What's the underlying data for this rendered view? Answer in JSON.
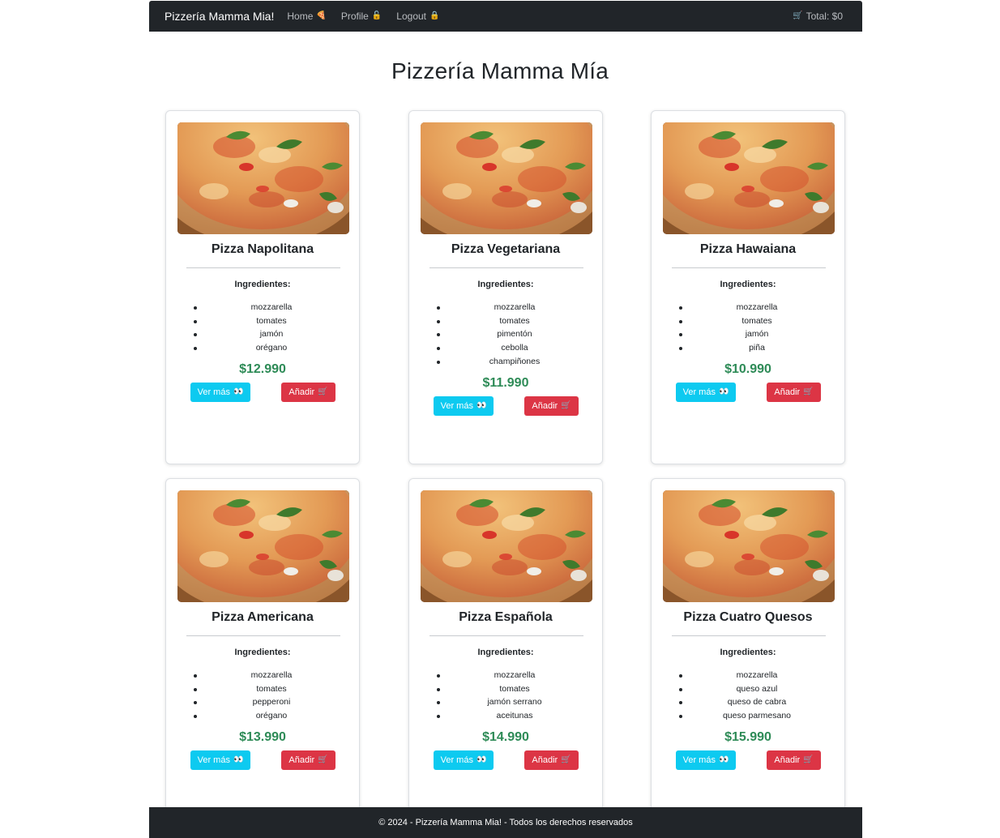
{
  "navbar": {
    "brand": "Pizzería Mamma Mia!",
    "links": [
      {
        "label": "Home",
        "icon": "🍕"
      },
      {
        "label": "Profile",
        "icon": "🔓"
      },
      {
        "label": "Logout",
        "icon": "🔒"
      }
    ],
    "total_icon": "🛒",
    "total_label": "Total: $0"
  },
  "page": {
    "title": "Pizzería Mamma Mía"
  },
  "labels": {
    "ingredients": "Ingredientes:",
    "view_more": "Ver más",
    "view_more_icon": "👀",
    "add": "Añadir",
    "add_icon": "🛒"
  },
  "pizzas": [
    {
      "name": "Pizza Napolitana",
      "ingredients": [
        "mozzarella",
        "tomates",
        "jamón",
        "orégano"
      ],
      "price": "$12.990"
    },
    {
      "name": "Pizza Vegetariana",
      "ingredients": [
        "mozzarella",
        "tomates",
        "pimentón",
        "cebolla",
        "champiñones"
      ],
      "price": "$11.990"
    },
    {
      "name": "Pizza Hawaiana",
      "ingredients": [
        "mozzarella",
        "tomates",
        "jamón",
        "piña"
      ],
      "price": "$10.990"
    },
    {
      "name": "Pizza Americana",
      "ingredients": [
        "mozzarella",
        "tomates",
        "pepperoni",
        "orégano"
      ],
      "price": "$13.990"
    },
    {
      "name": "Pizza Española",
      "ingredients": [
        "mozzarella",
        "tomates",
        "jamón serrano",
        "aceitunas"
      ],
      "price": "$14.990"
    },
    {
      "name": "Pizza Cuatro Quesos",
      "ingredients": [
        "mozzarella",
        "queso azul",
        "queso de cabra",
        "queso parmesano"
      ],
      "price": "$15.990"
    }
  ],
  "footer": {
    "text": "© 2024 - Pizzería Mamma Mia! - Todos los derechos reservados"
  },
  "colors": {
    "navbar": "#212529",
    "price": "#2e8b57",
    "info": "#0dcaf0",
    "danger": "#dc3545"
  }
}
